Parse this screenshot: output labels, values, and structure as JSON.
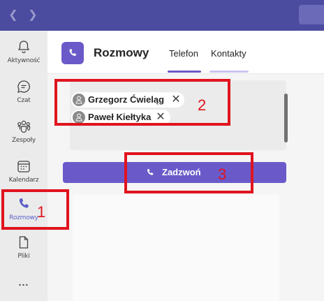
{
  "titlebar": {
    "back_icon": "chevron-left-icon",
    "forward_icon": "chevron-right-icon"
  },
  "rail": {
    "items": [
      {
        "label": "Aktywność",
        "icon": "bell-icon"
      },
      {
        "label": "Czat",
        "icon": "chat-icon"
      },
      {
        "label": "Zespoły",
        "icon": "teams-icon"
      },
      {
        "label": "Kalendarz",
        "icon": "calendar-icon"
      },
      {
        "label": "Rozmowy",
        "icon": "phone-icon",
        "active": true
      },
      {
        "label": "Pliki",
        "icon": "file-icon"
      }
    ],
    "more_label": "..."
  },
  "header": {
    "title": "Rozmowy",
    "tabs": [
      {
        "label": "Telefon",
        "active": true
      },
      {
        "label": "Kontakty",
        "active": false
      }
    ]
  },
  "recipients": [
    {
      "name": "Grzegorz Ćwieląg",
      "remove_icon": "close-icon"
    },
    {
      "name": "Paweł Kiełtyka",
      "remove_icon": "close-icon"
    }
  ],
  "call_button": {
    "label": "Zadzwoń",
    "icon": "phone-icon"
  },
  "annotations": [
    {
      "number": "1",
      "target": "rail-item-rozmowy"
    },
    {
      "number": "2",
      "target": "recipients-box"
    },
    {
      "number": "3",
      "target": "call-button"
    }
  ],
  "colors": {
    "titlebar": "#4b4ba0",
    "accent": "#6a5ac9",
    "annotation": "#e0141e"
  }
}
